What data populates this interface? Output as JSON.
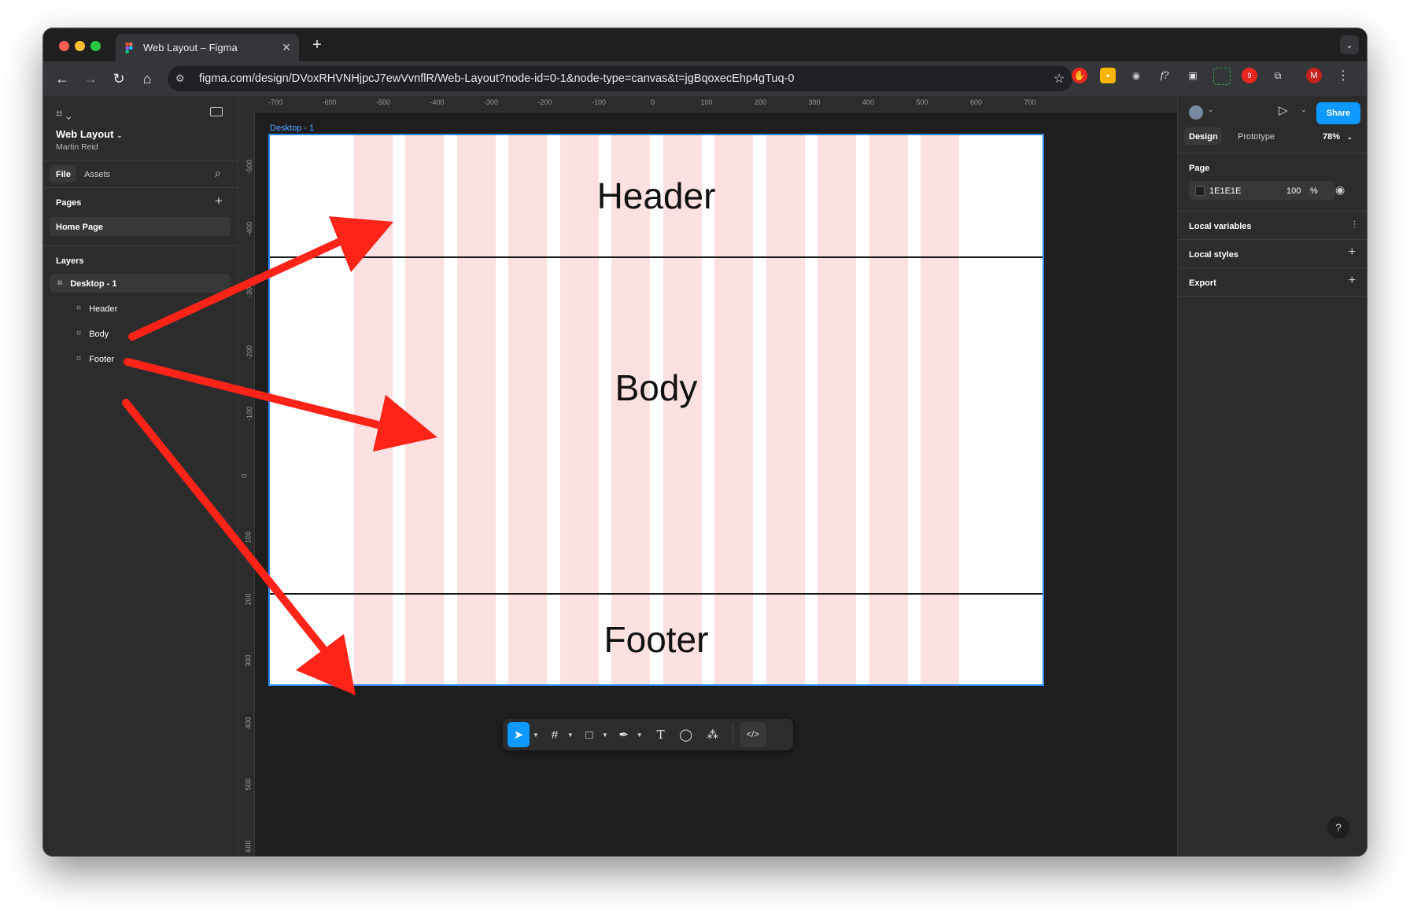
{
  "browser": {
    "tab_title": "Web Layout – Figma",
    "new_tab": "+",
    "url": "figma.com/design/DVoxRHVNHjpcJ7ewVvnflR/Web-Layout?node-id=0-1&node-type=canvas&t=jgBqoxecEhp4gTuq-0",
    "ext_badge": "9",
    "profile_initial": "M"
  },
  "file": {
    "name": "Web Layout",
    "owner": "Martin Reid"
  },
  "left_panel": {
    "tabs": [
      "File",
      "Assets"
    ],
    "pages_heading": "Pages",
    "pages": [
      "Home Page"
    ],
    "layers_heading": "Layers",
    "layers": [
      {
        "name": "Desktop - 1",
        "level": 0
      },
      {
        "name": "Header",
        "level": 1
      },
      {
        "name": "Body",
        "level": 1
      },
      {
        "name": "Footer",
        "level": 1
      }
    ]
  },
  "canvas": {
    "ruler_top": [
      "-700",
      "-600",
      "-500",
      "-400",
      "-300",
      "-200",
      "-100",
      "0",
      "100",
      "200",
      "300",
      "400",
      "500",
      "600",
      "700"
    ],
    "ruler_left": [
      "-500",
      "-400",
      "-300",
      "-200",
      "-100",
      "0",
      "100",
      "200",
      "300",
      "400",
      "500",
      "600"
    ],
    "frame_label": "Desktop - 1",
    "sections": {
      "header": "Header",
      "body": "Body",
      "footer": "Footer"
    },
    "grid_color": "#fde0e0",
    "arrow_color": "#ff2318"
  },
  "right_panel": {
    "tabs": [
      "Design",
      "Prototype"
    ],
    "zoom": "78%",
    "share": "Share",
    "page_heading": "Page",
    "page_color": "1E1E1E",
    "page_opacity": "100",
    "percent": "%",
    "local_variables": "Local variables",
    "local_styles": "Local styles",
    "export": "Export",
    "help": "?"
  },
  "colors": {
    "accent": "#0d99ff",
    "panel": "#2c2c2c",
    "canvas": "#1e1e1e"
  }
}
